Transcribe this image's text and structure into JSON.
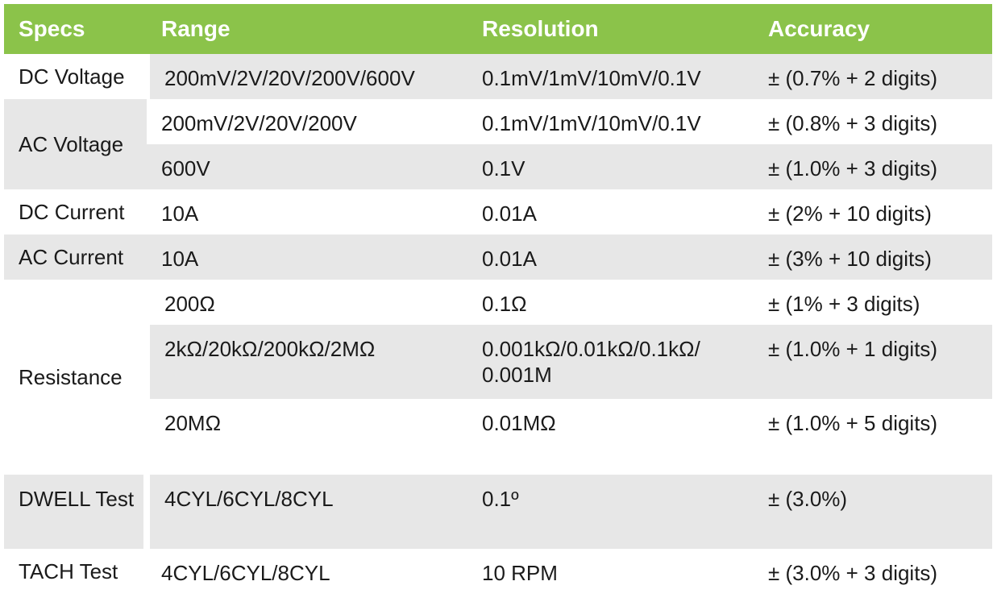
{
  "header": {
    "specs": "Specs",
    "range": "Range",
    "resolution": "Resolution",
    "accuracy": "Accuracy"
  },
  "rows": {
    "dc_voltage": {
      "spec": "DC Voltage",
      "range": "200mV/2V/20V/200V/600V",
      "resolution": "0.1mV/1mV/10mV/0.1V",
      "accuracy": "± (0.7% + 2 digits)"
    },
    "ac_voltage_1": {
      "spec": "AC Voltage",
      "range": "200mV/2V/20V/200V",
      "resolution": "0.1mV/1mV/10mV/0.1V",
      "accuracy": "± (0.8% + 3 digits)"
    },
    "ac_voltage_2": {
      "range": "600V",
      "resolution": "0.1V",
      "accuracy": "± (1.0% + 3 digits)"
    },
    "dc_current": {
      "spec": "DC Current",
      "range": "10A",
      "resolution": "0.01A",
      "accuracy": "± (2% + 10 digits)"
    },
    "ac_current": {
      "spec": "AC Current",
      "range": "10A",
      "resolution": "0.01A",
      "accuracy": "± (3% + 10 digits)"
    },
    "resistance_1": {
      "spec": "Resistance",
      "range": "200Ω",
      "resolution": "0.1Ω",
      "accuracy": "± (1% + 3 digits)"
    },
    "resistance_2": {
      "range": "2kΩ/20kΩ/200kΩ/2MΩ",
      "resolution": "0.001kΩ/0.01kΩ/0.1kΩ/ 0.001M",
      "accuracy": "± (1.0% + 1 digits)"
    },
    "resistance_3": {
      "range": "20MΩ",
      "resolution": "0.01MΩ",
      "accuracy": "± (1.0% + 5 digits)"
    },
    "dwell": {
      "spec": "DWELL Test",
      "range": "4CYL/6CYL/8CYL",
      "resolution": "0.1º",
      "accuracy": "± (3.0%)"
    },
    "tach": {
      "spec": "TACH Test",
      "range": "4CYL/6CYL/8CYL",
      "resolution": "10 RPM",
      "accuracy": "± (3.0% + 3 digits)"
    }
  },
  "colors": {
    "header_bg": "#8bc34a",
    "header_text": "#ffffff",
    "stripe": "#e7e7e7"
  }
}
